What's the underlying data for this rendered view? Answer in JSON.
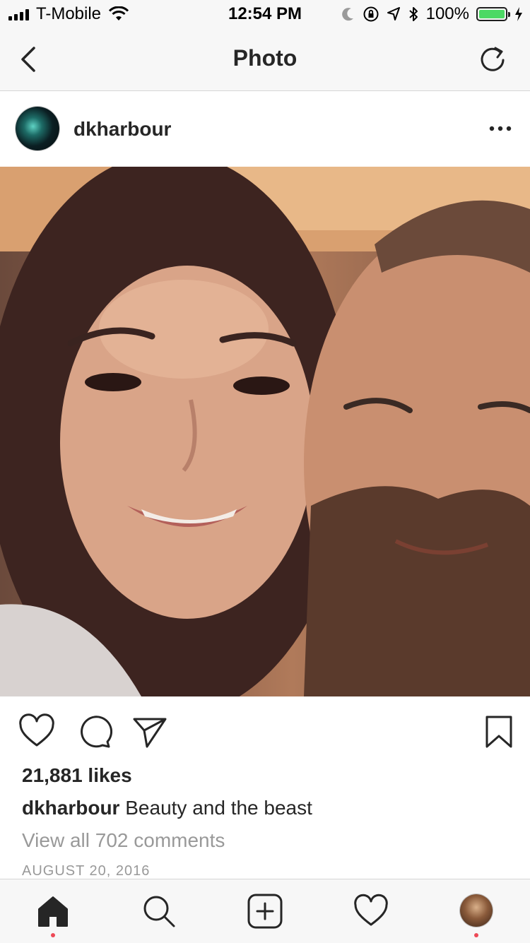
{
  "status_bar": {
    "carrier": "T-Mobile",
    "time": "12:54 PM",
    "battery_percent": "100%",
    "battery_level": 1.0,
    "icons": [
      "signal-icon",
      "wifi-icon",
      "moon-icon",
      "rotation-lock-icon",
      "location-icon",
      "bluetooth-icon",
      "battery-icon",
      "charging-icon"
    ]
  },
  "nav": {
    "title": "Photo",
    "back_icon": "chevron-left-icon",
    "refresh_icon": "refresh-icon"
  },
  "post": {
    "username": "dkharbour",
    "more_icon": "more-horizontal-icon",
    "likes": "21,881 likes",
    "caption_user": "dkharbour",
    "caption_text": "Beauty and the beast",
    "comments_link": "View all 702 comments",
    "date": "AUGUST 20, 2016",
    "actions": [
      "heart-icon",
      "comment-icon",
      "share-icon",
      "bookmark-icon"
    ]
  },
  "tab_bar": {
    "items": [
      "home-icon",
      "search-icon",
      "add-post-icon",
      "activity-heart-icon",
      "profile-avatar"
    ],
    "notification_color": "#ed4956"
  },
  "colors": {
    "text": "#262626",
    "muted": "#999999",
    "bar_bg": "#f7f7f7",
    "battery_green": "#4cd964"
  }
}
